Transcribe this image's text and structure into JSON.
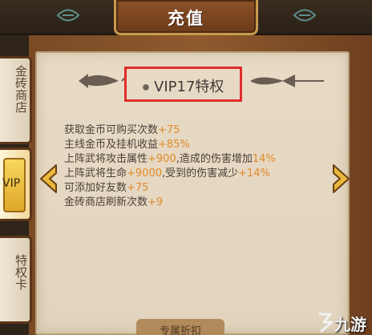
{
  "window": {
    "title": "充值"
  },
  "side_tabs": [
    {
      "label": "金砖商店",
      "active": false
    },
    {
      "label": "VIP",
      "active": true
    },
    {
      "label": "特权卡",
      "active": false
    }
  ],
  "panel": {
    "heading": "VIP17特权",
    "perks": [
      {
        "text": "获取金币可购买次数",
        "value": "+75"
      },
      {
        "text": "主线金币及挂机收益",
        "value": "+85%"
      },
      {
        "text": "上阵武将攻击属性",
        "value": "+900",
        "text2": ",造成的伤害增加",
        "value2": "14%"
      },
      {
        "text": "上阵武将生命",
        "value": "+9000",
        "text2": ",受到的伤害减少",
        "value2": "+14%"
      },
      {
        "text": "可添加好友数",
        "value": "+75"
      },
      {
        "text": "金砖商店刷新次数",
        "value": "+9"
      }
    ]
  },
  "footer_tab": {
    "label": "专属折扣"
  },
  "watermark": {
    "text": "九游"
  },
  "colors": {
    "value": "#e08a2a",
    "highlight_box": "#e02d2d",
    "wood": "#8f5a2e",
    "paper": "#e8dbc6"
  },
  "icons": [
    "fish-ornament-icon",
    "arrow-left-icon",
    "arrow-right-icon",
    "top-ornament-icon",
    "logo-icon"
  ]
}
